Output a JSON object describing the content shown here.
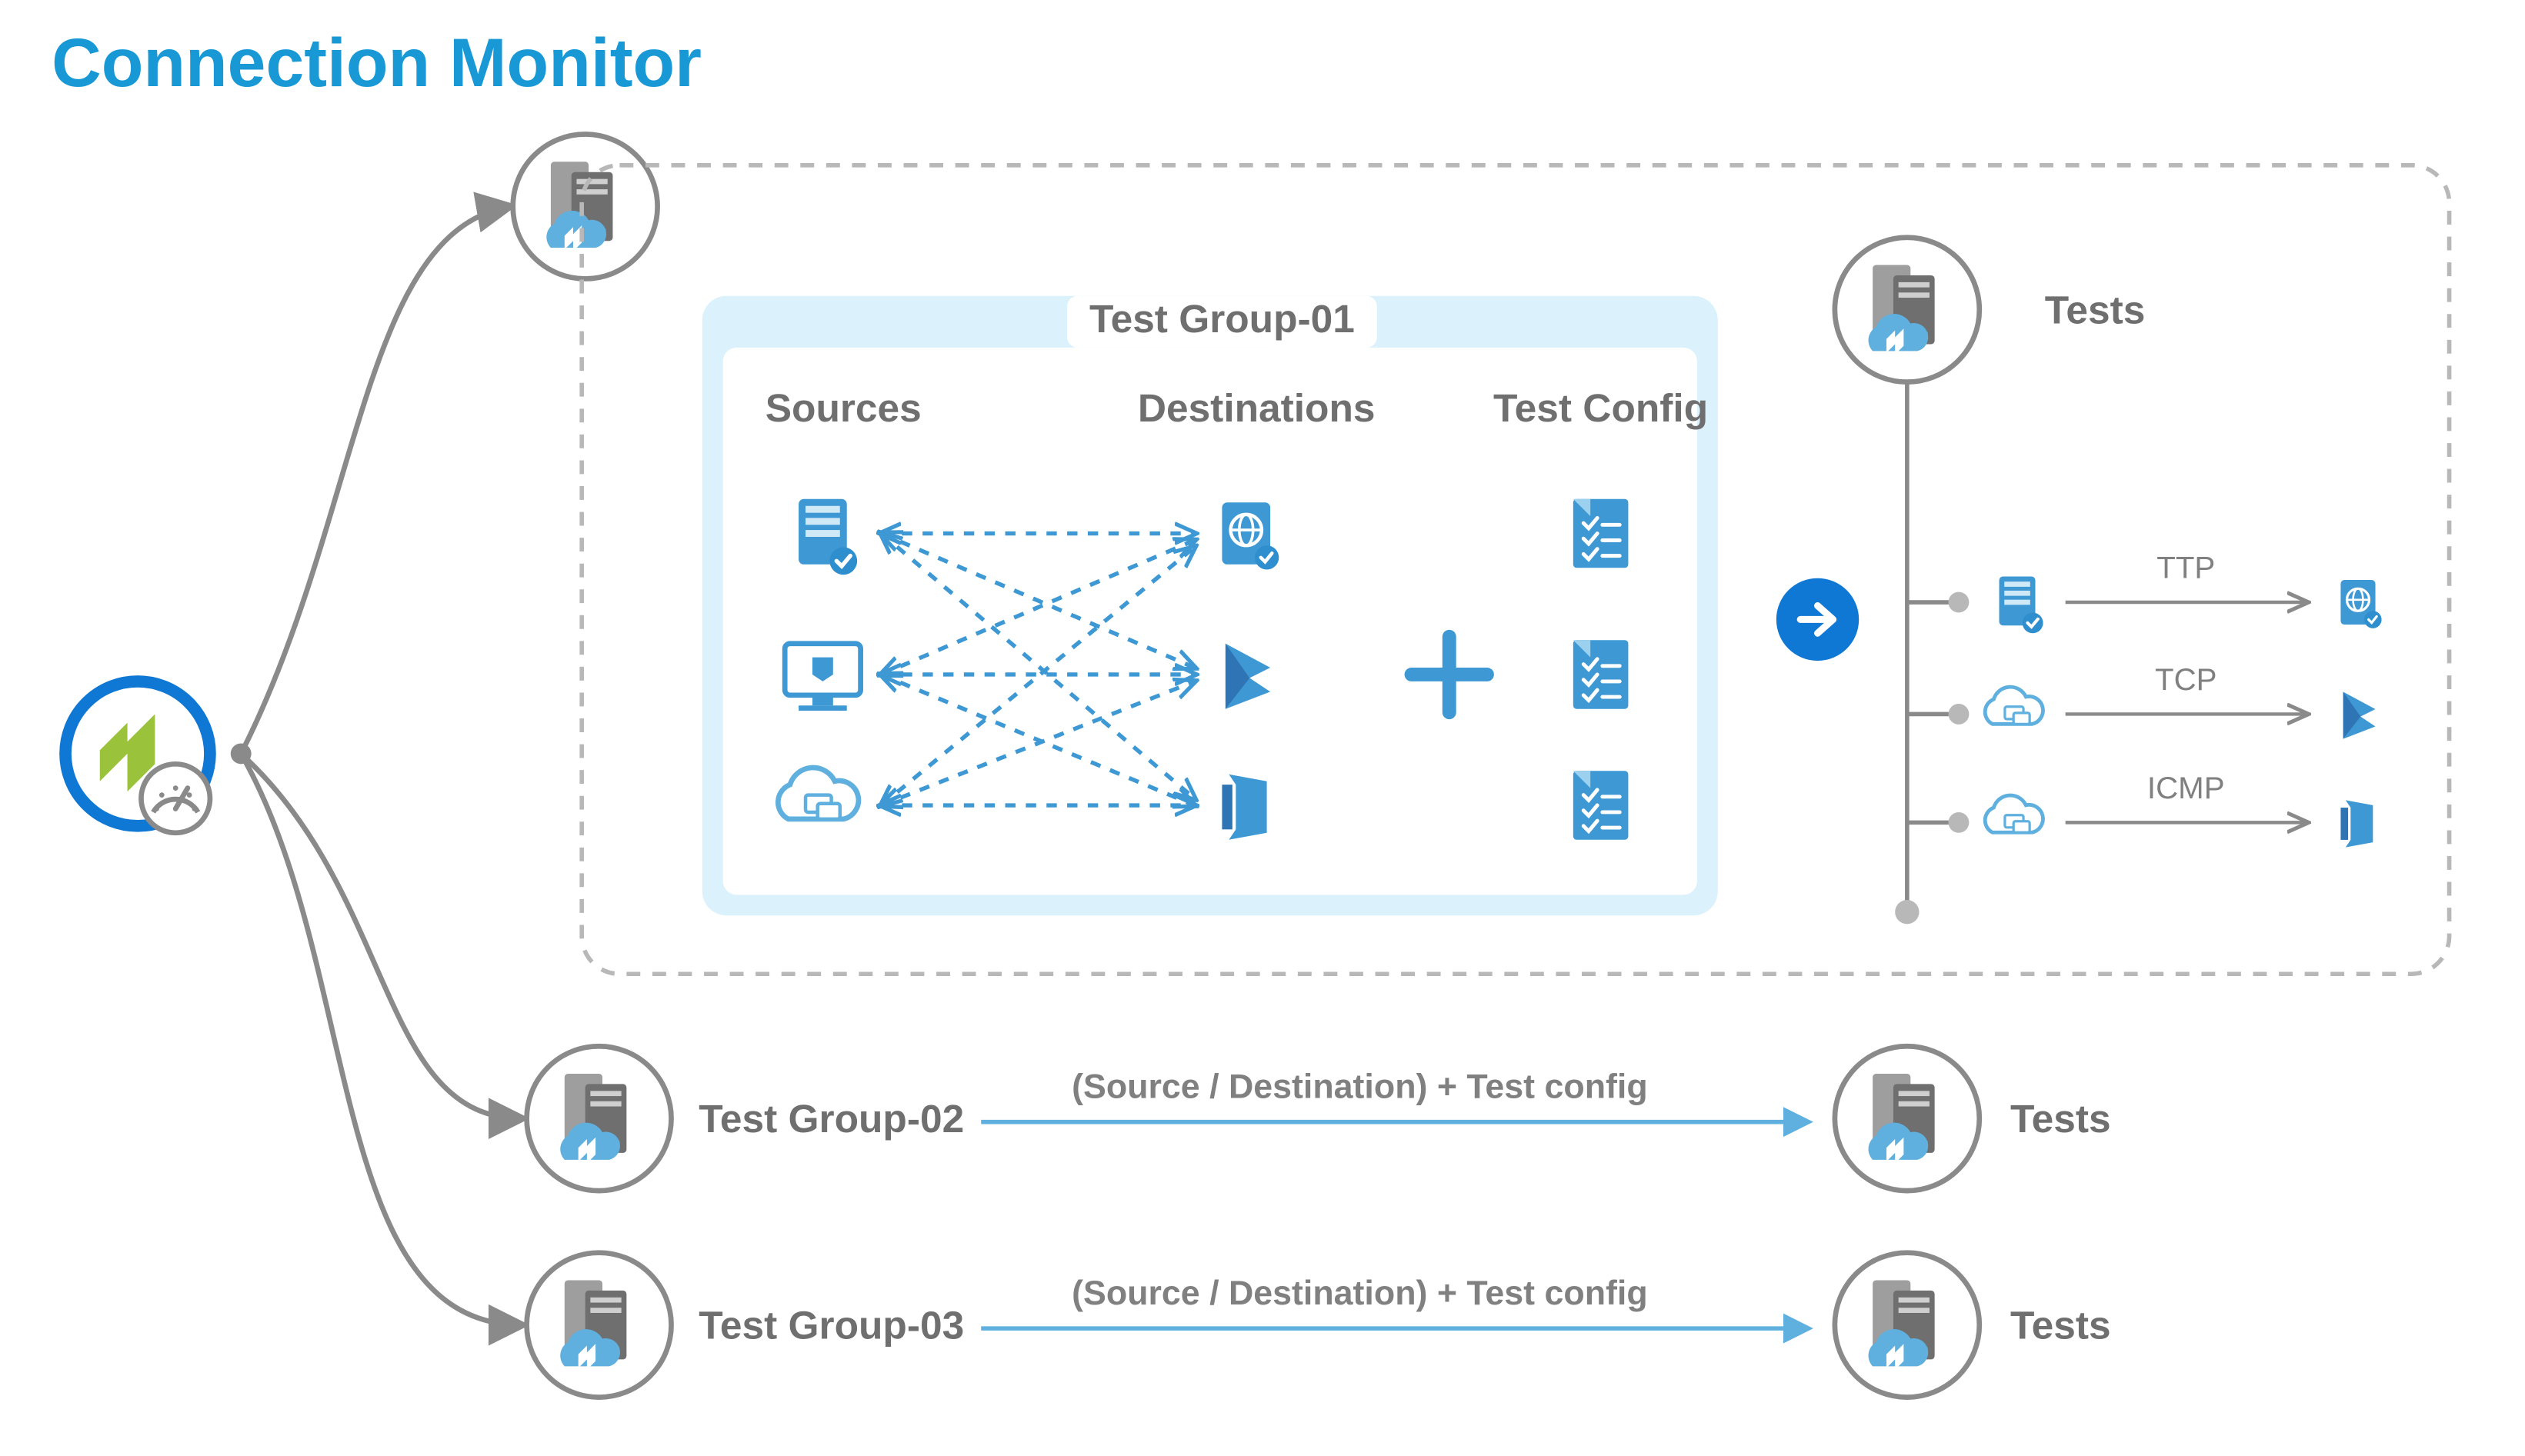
{
  "title": "Connection Monitor",
  "group1": {
    "title": "Test Group-01",
    "cols": {
      "sources": "Sources",
      "destinations": "Destinations",
      "testconfig": "Test Config"
    }
  },
  "tests": {
    "heading": "Tests",
    "protocols": [
      "TTP",
      "TCP",
      "ICMP"
    ]
  },
  "rows": [
    {
      "group": "Test Group-02",
      "mid": "(Source / Destination) + Test config",
      "tests": "Tests"
    },
    {
      "group": "Test Group-03",
      "mid": "(Source / Destination) + Test config",
      "tests": "Tests"
    }
  ],
  "colors": {
    "title": "#1899d6",
    "gray": "#7d7d7d",
    "blue": "#3e98d3",
    "lightblue": "#dbf1fb",
    "midblue": "#5fb0de",
    "darkblue": "#2f74b5",
    "accent": "#0f78d4"
  }
}
